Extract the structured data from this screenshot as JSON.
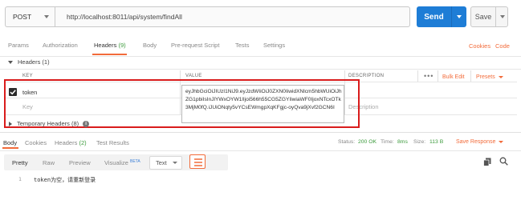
{
  "request": {
    "method": "POST",
    "url": "http://localhost:8011/api/system/findAll",
    "send_label": "Send",
    "save_label": "Save"
  },
  "request_tabs": {
    "params": "Params",
    "authorization": "Authorization",
    "headers": "Headers",
    "headers_count": "(9)",
    "body": "Body",
    "pre_request": "Pre-request Script",
    "tests": "Tests",
    "settings": "Settings",
    "cookies": "Cookies",
    "code": "Code"
  },
  "headers_section": {
    "title": "Headers (1)",
    "col_key": "KEY",
    "col_value": "VALUE",
    "col_description": "DESCRIPTION",
    "more": "•••",
    "bulk_edit": "Bulk Edit",
    "presets": "Presets",
    "rows": [
      {
        "key": "token",
        "value": "eyJhbGciOiJIUzI1NiJ9.eyJzdWIiOiJ0ZXN0IiwidXNlcm5hbWUiOiJhZG1pbiIsInJlYWxOYW1lIjoi566h55CG5ZGYIiwiaWF0IjoxNTcxOTk3MjM0fQ.iJUiONqty5vYCsEWmgpXqKFgjc-oyQva9jXvf2GCN6I",
        "checked": true
      }
    ],
    "key_placeholder": "Key",
    "description_placeholder": "Description",
    "temporary": "Temporary Headers (8)"
  },
  "response_tabs": {
    "body": "Body",
    "cookies": "Cookies",
    "headers": "Headers",
    "headers_count": "(2)",
    "test_results": "Test Results",
    "status_label": "Status:",
    "status_value": "200 OK",
    "time_label": "Time:",
    "time_value": "8ms",
    "size_label": "Size:",
    "size_value": "113 B",
    "save_response": "Save Response"
  },
  "format_bar": {
    "pretty": "Pretty",
    "raw": "Raw",
    "preview": "Preview",
    "visualize": "Visualize",
    "beta": "BETA",
    "text_select": "Text"
  },
  "response_body": {
    "line_number": "1",
    "content": "token为空，请重新登录"
  },
  "colors": {
    "accent": "#f26b3a",
    "send": "#1e7dd6",
    "success": "#3b9a3b",
    "highlight": "#d91c1c"
  }
}
